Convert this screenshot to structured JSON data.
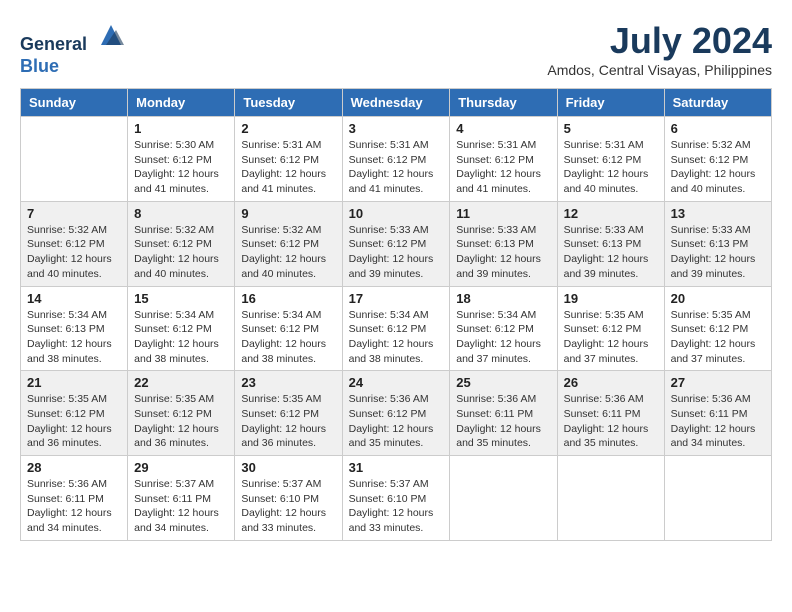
{
  "header": {
    "logo_line1": "General",
    "logo_line2": "Blue",
    "month_year": "July 2024",
    "location": "Amdos, Central Visayas, Philippines"
  },
  "weekdays": [
    "Sunday",
    "Monday",
    "Tuesday",
    "Wednesday",
    "Thursday",
    "Friday",
    "Saturday"
  ],
  "weeks": [
    [
      {
        "day": "",
        "info": ""
      },
      {
        "day": "1",
        "info": "Sunrise: 5:30 AM\nSunset: 6:12 PM\nDaylight: 12 hours\nand 41 minutes."
      },
      {
        "day": "2",
        "info": "Sunrise: 5:31 AM\nSunset: 6:12 PM\nDaylight: 12 hours\nand 41 minutes."
      },
      {
        "day": "3",
        "info": "Sunrise: 5:31 AM\nSunset: 6:12 PM\nDaylight: 12 hours\nand 41 minutes."
      },
      {
        "day": "4",
        "info": "Sunrise: 5:31 AM\nSunset: 6:12 PM\nDaylight: 12 hours\nand 41 minutes."
      },
      {
        "day": "5",
        "info": "Sunrise: 5:31 AM\nSunset: 6:12 PM\nDaylight: 12 hours\nand 40 minutes."
      },
      {
        "day": "6",
        "info": "Sunrise: 5:32 AM\nSunset: 6:12 PM\nDaylight: 12 hours\nand 40 minutes."
      }
    ],
    [
      {
        "day": "7",
        "info": "Sunrise: 5:32 AM\nSunset: 6:12 PM\nDaylight: 12 hours\nand 40 minutes."
      },
      {
        "day": "8",
        "info": "Sunrise: 5:32 AM\nSunset: 6:12 PM\nDaylight: 12 hours\nand 40 minutes."
      },
      {
        "day": "9",
        "info": "Sunrise: 5:32 AM\nSunset: 6:12 PM\nDaylight: 12 hours\nand 40 minutes."
      },
      {
        "day": "10",
        "info": "Sunrise: 5:33 AM\nSunset: 6:12 PM\nDaylight: 12 hours\nand 39 minutes."
      },
      {
        "day": "11",
        "info": "Sunrise: 5:33 AM\nSunset: 6:13 PM\nDaylight: 12 hours\nand 39 minutes."
      },
      {
        "day": "12",
        "info": "Sunrise: 5:33 AM\nSunset: 6:13 PM\nDaylight: 12 hours\nand 39 minutes."
      },
      {
        "day": "13",
        "info": "Sunrise: 5:33 AM\nSunset: 6:13 PM\nDaylight: 12 hours\nand 39 minutes."
      }
    ],
    [
      {
        "day": "14",
        "info": "Sunrise: 5:34 AM\nSunset: 6:13 PM\nDaylight: 12 hours\nand 38 minutes."
      },
      {
        "day": "15",
        "info": "Sunrise: 5:34 AM\nSunset: 6:12 PM\nDaylight: 12 hours\nand 38 minutes."
      },
      {
        "day": "16",
        "info": "Sunrise: 5:34 AM\nSunset: 6:12 PM\nDaylight: 12 hours\nand 38 minutes."
      },
      {
        "day": "17",
        "info": "Sunrise: 5:34 AM\nSunset: 6:12 PM\nDaylight: 12 hours\nand 38 minutes."
      },
      {
        "day": "18",
        "info": "Sunrise: 5:34 AM\nSunset: 6:12 PM\nDaylight: 12 hours\nand 37 minutes."
      },
      {
        "day": "19",
        "info": "Sunrise: 5:35 AM\nSunset: 6:12 PM\nDaylight: 12 hours\nand 37 minutes."
      },
      {
        "day": "20",
        "info": "Sunrise: 5:35 AM\nSunset: 6:12 PM\nDaylight: 12 hours\nand 37 minutes."
      }
    ],
    [
      {
        "day": "21",
        "info": "Sunrise: 5:35 AM\nSunset: 6:12 PM\nDaylight: 12 hours\nand 36 minutes."
      },
      {
        "day": "22",
        "info": "Sunrise: 5:35 AM\nSunset: 6:12 PM\nDaylight: 12 hours\nand 36 minutes."
      },
      {
        "day": "23",
        "info": "Sunrise: 5:35 AM\nSunset: 6:12 PM\nDaylight: 12 hours\nand 36 minutes."
      },
      {
        "day": "24",
        "info": "Sunrise: 5:36 AM\nSunset: 6:12 PM\nDaylight: 12 hours\nand 35 minutes."
      },
      {
        "day": "25",
        "info": "Sunrise: 5:36 AM\nSunset: 6:11 PM\nDaylight: 12 hours\nand 35 minutes."
      },
      {
        "day": "26",
        "info": "Sunrise: 5:36 AM\nSunset: 6:11 PM\nDaylight: 12 hours\nand 35 minutes."
      },
      {
        "day": "27",
        "info": "Sunrise: 5:36 AM\nSunset: 6:11 PM\nDaylight: 12 hours\nand 34 minutes."
      }
    ],
    [
      {
        "day": "28",
        "info": "Sunrise: 5:36 AM\nSunset: 6:11 PM\nDaylight: 12 hours\nand 34 minutes."
      },
      {
        "day": "29",
        "info": "Sunrise: 5:37 AM\nSunset: 6:11 PM\nDaylight: 12 hours\nand 34 minutes."
      },
      {
        "day": "30",
        "info": "Sunrise: 5:37 AM\nSunset: 6:10 PM\nDaylight: 12 hours\nand 33 minutes."
      },
      {
        "day": "31",
        "info": "Sunrise: 5:37 AM\nSunset: 6:10 PM\nDaylight: 12 hours\nand 33 minutes."
      },
      {
        "day": "",
        "info": ""
      },
      {
        "day": "",
        "info": ""
      },
      {
        "day": "",
        "info": ""
      }
    ]
  ]
}
